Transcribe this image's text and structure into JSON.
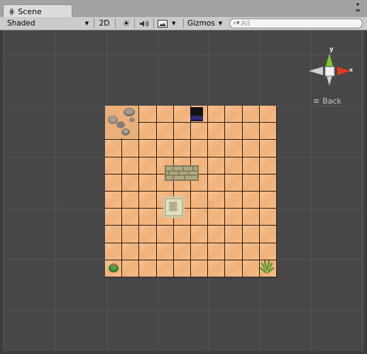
{
  "window": {
    "tab_label": "Scene",
    "tab_icon": "grid-icon",
    "menu_icon": "window-menu-icon"
  },
  "toolbar": {
    "shading_mode": "Shaded",
    "mode_2d": "2D",
    "lighting_icon": "sun-icon",
    "audio_icon": "speaker-icon",
    "effects_icon": "image-icon",
    "gizmos_label": "Gizmos",
    "search_placeholder": "All",
    "search_icon": "search-icon"
  },
  "scene": {
    "orientation_gizmo": {
      "y_label": "y",
      "x_label": "x",
      "view_label": "Back"
    },
    "tilemap": {
      "columns": 10,
      "rows": 10,
      "objects": [
        {
          "name": "rocks",
          "row": 0,
          "col": 0
        },
        {
          "name": "dark-doorway",
          "row": 0,
          "col": 5
        },
        {
          "name": "stone-wall",
          "row": 3,
          "col": 4
        },
        {
          "name": "stone-tile",
          "row": 5,
          "col": 4
        },
        {
          "name": "faint-object",
          "row": 5,
          "col": 6
        },
        {
          "name": "cactus",
          "row": 9,
          "col": 0
        },
        {
          "name": "desert-shrub",
          "row": 9,
          "col": 9
        }
      ]
    }
  },
  "colors": {
    "viewport_bg": "#474747",
    "sand": "#f4b781",
    "gizmo_y": "#7ec52a",
    "gizmo_x": "#e03a1e"
  }
}
